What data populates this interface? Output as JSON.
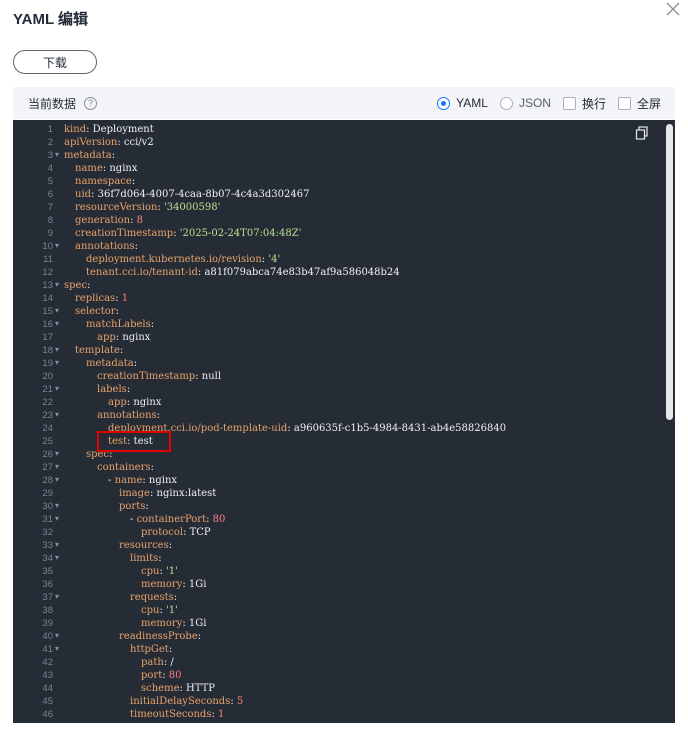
{
  "dialog": {
    "title": "YAML 编辑",
    "download_label": "下载"
  },
  "toolbar": {
    "current_label": "当前数据",
    "help_icon_text": "?",
    "yaml_label": "YAML",
    "json_label": "JSON",
    "wrap_label": "换行",
    "fullscreen_label": "全屏",
    "selected_format": "YAML"
  },
  "icons": {
    "close": "close-icon",
    "help": "help-circle-icon",
    "copy": "copy-icon",
    "fold": "fold-caret-icon"
  },
  "colors": {
    "editor_bg": "#262c36",
    "key": "#e8a26a",
    "value": "#eef0f4",
    "number": "#ff7e7e",
    "string": "#b9e08e",
    "highlight": "#e00000",
    "accent": "#1677ff"
  },
  "editor": {
    "highlighted_line": 25,
    "lines": [
      {
        "n": "1",
        "fold": false,
        "indent": 0,
        "tokens": [
          [
            "k",
            "kind"
          ],
          [
            "v",
            ": Deployment"
          ]
        ]
      },
      {
        "n": "2",
        "fold": false,
        "indent": 0,
        "tokens": [
          [
            "k",
            "apiVersion"
          ],
          [
            "v",
            ": cci/v2"
          ]
        ]
      },
      {
        "n": "3",
        "fold": true,
        "indent": 0,
        "tokens": [
          [
            "k",
            "metadata"
          ],
          [
            "v",
            ":"
          ]
        ]
      },
      {
        "n": "4",
        "fold": false,
        "indent": 1,
        "tokens": [
          [
            "k",
            "name"
          ],
          [
            "v",
            ": nginx"
          ]
        ]
      },
      {
        "n": "5",
        "fold": false,
        "indent": 1,
        "tokens": [
          [
            "k",
            "namespace"
          ],
          [
            "v",
            ":"
          ]
        ]
      },
      {
        "n": "6",
        "fold": false,
        "indent": 1,
        "tokens": [
          [
            "k",
            "uid"
          ],
          [
            "v",
            ": 36f7d064-4007-4caa-8b07-4c4a3d302467"
          ]
        ]
      },
      {
        "n": "7",
        "fold": false,
        "indent": 1,
        "tokens": [
          [
            "k",
            "resourceVersion"
          ],
          [
            "v",
            ": "
          ],
          [
            "s",
            "'34000598'"
          ]
        ]
      },
      {
        "n": "8",
        "fold": false,
        "indent": 1,
        "tokens": [
          [
            "k",
            "generation"
          ],
          [
            "v",
            ": "
          ],
          [
            "n",
            "8"
          ]
        ]
      },
      {
        "n": "9",
        "fold": false,
        "indent": 1,
        "tokens": [
          [
            "k",
            "creationTimestamp"
          ],
          [
            "v",
            ": "
          ],
          [
            "s",
            "'2025-02-24T07:04:48Z'"
          ]
        ]
      },
      {
        "n": "10",
        "fold": true,
        "indent": 1,
        "tokens": [
          [
            "k",
            "annotations"
          ],
          [
            "v",
            ":"
          ]
        ]
      },
      {
        "n": "11",
        "fold": false,
        "indent": 2,
        "tokens": [
          [
            "k",
            "deployment.kubernetes.io/revision"
          ],
          [
            "v",
            ": "
          ],
          [
            "s",
            "'4'"
          ]
        ]
      },
      {
        "n": "12",
        "fold": false,
        "indent": 2,
        "tokens": [
          [
            "k",
            "tenant.cci.io/tenant-id"
          ],
          [
            "v",
            ": a81f079abca74e83b47af9a586048b24"
          ]
        ]
      },
      {
        "n": "13",
        "fold": true,
        "indent": 0,
        "tokens": [
          [
            "k",
            "spec"
          ],
          [
            "v",
            ":"
          ]
        ]
      },
      {
        "n": "14",
        "fold": false,
        "indent": 1,
        "tokens": [
          [
            "k",
            "replicas"
          ],
          [
            "v",
            ": "
          ],
          [
            "n",
            "1"
          ]
        ]
      },
      {
        "n": "15",
        "fold": true,
        "indent": 1,
        "tokens": [
          [
            "k",
            "selector"
          ],
          [
            "v",
            ":"
          ]
        ]
      },
      {
        "n": "16",
        "fold": true,
        "indent": 2,
        "tokens": [
          [
            "k",
            "matchLabels"
          ],
          [
            "v",
            ":"
          ]
        ]
      },
      {
        "n": "17",
        "fold": false,
        "indent": 3,
        "tokens": [
          [
            "k",
            "app"
          ],
          [
            "v",
            ": nginx"
          ]
        ]
      },
      {
        "n": "18",
        "fold": true,
        "indent": 1,
        "tokens": [
          [
            "k",
            "template"
          ],
          [
            "v",
            ":"
          ]
        ]
      },
      {
        "n": "19",
        "fold": true,
        "indent": 2,
        "tokens": [
          [
            "k",
            "metadata"
          ],
          [
            "v",
            ":"
          ]
        ]
      },
      {
        "n": "20",
        "fold": false,
        "indent": 3,
        "tokens": [
          [
            "k",
            "creationTimestamp"
          ],
          [
            "v",
            ": null"
          ]
        ]
      },
      {
        "n": "21",
        "fold": true,
        "indent": 3,
        "tokens": [
          [
            "k",
            "labels"
          ],
          [
            "v",
            ":"
          ]
        ]
      },
      {
        "n": "22",
        "fold": false,
        "indent": 4,
        "tokens": [
          [
            "k",
            "app"
          ],
          [
            "v",
            ": nginx"
          ]
        ]
      },
      {
        "n": "23",
        "fold": true,
        "indent": 3,
        "tokens": [
          [
            "k",
            "annotations"
          ],
          [
            "v",
            ":"
          ]
        ]
      },
      {
        "n": "24",
        "fold": false,
        "indent": 4,
        "tokens": [
          [
            "k",
            "deployment.cci.io/pod-template-uid"
          ],
          [
            "v",
            ": a960635f-c1b5-4984-8431-ab4e58826840"
          ]
        ]
      },
      {
        "n": "25",
        "fold": false,
        "indent": 4,
        "tokens": [
          [
            "k",
            "test"
          ],
          [
            "v",
            ": test"
          ]
        ]
      },
      {
        "n": "26",
        "fold": true,
        "indent": 2,
        "tokens": [
          [
            "k",
            "spec"
          ],
          [
            "v",
            ":"
          ]
        ]
      },
      {
        "n": "27",
        "fold": true,
        "indent": 3,
        "tokens": [
          [
            "k",
            "containers"
          ],
          [
            "v",
            ":"
          ]
        ]
      },
      {
        "n": "28",
        "fold": true,
        "indent": 4,
        "tokens": [
          [
            "v",
            "- "
          ],
          [
            "k",
            "name"
          ],
          [
            "v",
            ": nginx"
          ]
        ]
      },
      {
        "n": "29",
        "fold": false,
        "indent": 5,
        "tokens": [
          [
            "k",
            "image"
          ],
          [
            "v",
            ": nginx:latest"
          ]
        ]
      },
      {
        "n": "30",
        "fold": true,
        "indent": 5,
        "tokens": [
          [
            "k",
            "ports"
          ],
          [
            "v",
            ":"
          ]
        ]
      },
      {
        "n": "31",
        "fold": true,
        "indent": 6,
        "tokens": [
          [
            "v",
            "- "
          ],
          [
            "k",
            "containerPort"
          ],
          [
            "v",
            ": "
          ],
          [
            "n",
            "80"
          ]
        ]
      },
      {
        "n": "32",
        "fold": false,
        "indent": 7,
        "tokens": [
          [
            "k",
            "protocol"
          ],
          [
            "v",
            ": TCP"
          ]
        ]
      },
      {
        "n": "33",
        "fold": true,
        "indent": 5,
        "tokens": [
          [
            "k",
            "resources"
          ],
          [
            "v",
            ":"
          ]
        ]
      },
      {
        "n": "34",
        "fold": true,
        "indent": 6,
        "tokens": [
          [
            "k",
            "limits"
          ],
          [
            "v",
            ":"
          ]
        ]
      },
      {
        "n": "35",
        "fold": false,
        "indent": 7,
        "tokens": [
          [
            "k",
            "cpu"
          ],
          [
            "v",
            ": "
          ],
          [
            "s",
            "'1'"
          ]
        ]
      },
      {
        "n": "36",
        "fold": false,
        "indent": 7,
        "tokens": [
          [
            "k",
            "memory"
          ],
          [
            "v",
            ": 1Gi"
          ]
        ]
      },
      {
        "n": "37",
        "fold": true,
        "indent": 6,
        "tokens": [
          [
            "k",
            "requests"
          ],
          [
            "v",
            ":"
          ]
        ]
      },
      {
        "n": "38",
        "fold": false,
        "indent": 7,
        "tokens": [
          [
            "k",
            "cpu"
          ],
          [
            "v",
            ": "
          ],
          [
            "s",
            "'1'"
          ]
        ]
      },
      {
        "n": "39",
        "fold": false,
        "indent": 7,
        "tokens": [
          [
            "k",
            "memory"
          ],
          [
            "v",
            ": 1Gi"
          ]
        ]
      },
      {
        "n": "40",
        "fold": true,
        "indent": 5,
        "tokens": [
          [
            "k",
            "readinessProbe"
          ],
          [
            "v",
            ":"
          ]
        ]
      },
      {
        "n": "41",
        "fold": true,
        "indent": 6,
        "tokens": [
          [
            "k",
            "httpGet"
          ],
          [
            "v",
            ":"
          ]
        ]
      },
      {
        "n": "42",
        "fold": false,
        "indent": 7,
        "tokens": [
          [
            "k",
            "path"
          ],
          [
            "v",
            ": /"
          ]
        ]
      },
      {
        "n": "43",
        "fold": false,
        "indent": 7,
        "tokens": [
          [
            "k",
            "port"
          ],
          [
            "v",
            ": "
          ],
          [
            "n",
            "80"
          ]
        ]
      },
      {
        "n": "44",
        "fold": false,
        "indent": 7,
        "tokens": [
          [
            "k",
            "scheme"
          ],
          [
            "v",
            ": HTTP"
          ]
        ]
      },
      {
        "n": "45",
        "fold": false,
        "indent": 6,
        "tokens": [
          [
            "k",
            "initialDelaySeconds"
          ],
          [
            "v",
            ": "
          ],
          [
            "n",
            "5"
          ]
        ]
      },
      {
        "n": "46",
        "fold": false,
        "indent": 6,
        "tokens": [
          [
            "k",
            "timeoutSeconds"
          ],
          [
            "v",
            ": "
          ],
          [
            "n",
            "1"
          ]
        ]
      }
    ]
  }
}
